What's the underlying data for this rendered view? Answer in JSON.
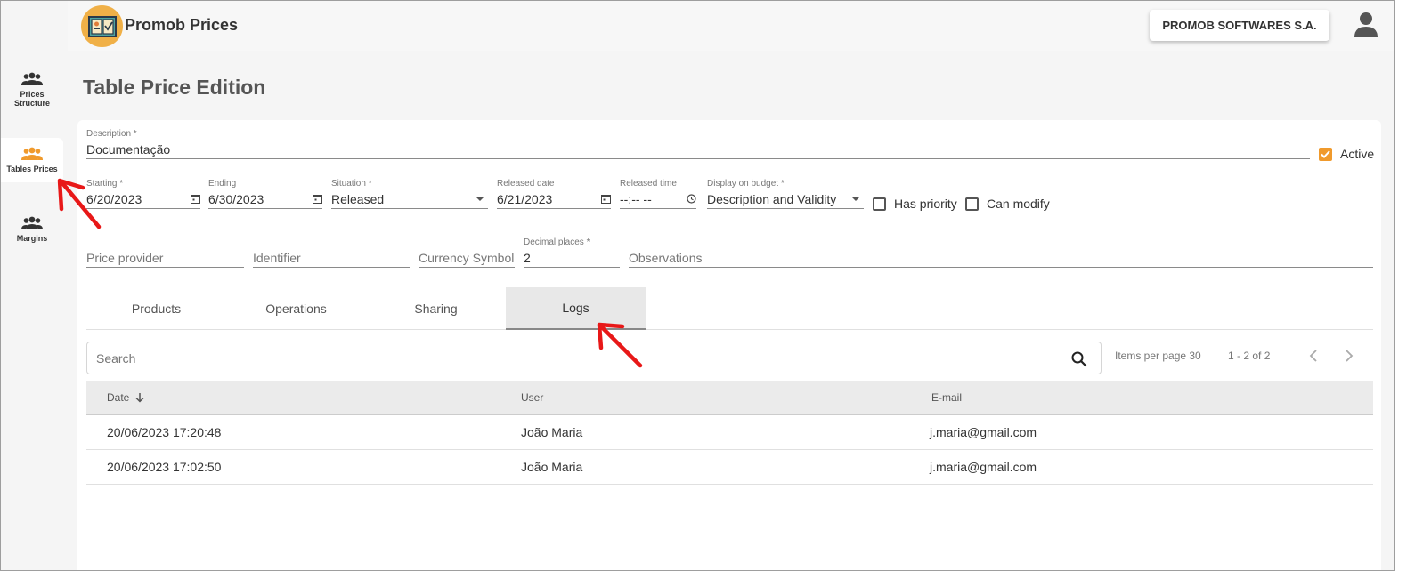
{
  "app": {
    "title": "Promob Prices",
    "company": "PROMOB SOFTWARES S.A."
  },
  "sidebar": {
    "items": [
      {
        "label": "Prices Structure"
      },
      {
        "label": "Tables Prices"
      },
      {
        "label": "Margins"
      }
    ]
  },
  "page": {
    "title": "Table Price Edition"
  },
  "form": {
    "description": {
      "label": "Description *",
      "value": "Documentação"
    },
    "active": {
      "label": "Active",
      "checked": true
    },
    "starting": {
      "label": "Starting *",
      "value": "6/20/2023"
    },
    "ending": {
      "label": "Ending",
      "value": "6/30/2023"
    },
    "situation": {
      "label": "Situation *",
      "value": "Released"
    },
    "released_date": {
      "label": "Released date",
      "value": "6/21/2023"
    },
    "released_time": {
      "label": "Released time",
      "value": "--:-- --"
    },
    "display_on_budget": {
      "label": "Display on budget *",
      "value": "Description and Validity"
    },
    "has_priority": {
      "label": "Has priority",
      "checked": false
    },
    "can_modify": {
      "label": "Can modify",
      "checked": false
    },
    "price_provider": {
      "placeholder": "Price provider"
    },
    "identifier": {
      "placeholder": "Identifier"
    },
    "currency_symbol": {
      "placeholder": "Currency Symbol"
    },
    "decimal_places": {
      "label": "Decimal places *",
      "value": "2"
    },
    "observations": {
      "placeholder": "Observations"
    }
  },
  "tabs": [
    {
      "label": "Products"
    },
    {
      "label": "Operations"
    },
    {
      "label": "Sharing"
    },
    {
      "label": "Logs",
      "active": true
    }
  ],
  "logs": {
    "search_placeholder": "Search",
    "items_per_page": "Items per page 30",
    "range": "1 - 2 of 2",
    "columns": [
      "Date",
      "User",
      "E-mail"
    ],
    "rows": [
      {
        "date": "20/06/2023 17:20:48",
        "user": "João Maria",
        "email": "j.maria@gmail.com"
      },
      {
        "date": "20/06/2023 17:02:50",
        "user": "João Maria",
        "email": "j.maria@gmail.com"
      }
    ]
  },
  "colors": {
    "accent": "#f09a2c",
    "logo": "#f0b047",
    "annotation": "#e81818"
  }
}
